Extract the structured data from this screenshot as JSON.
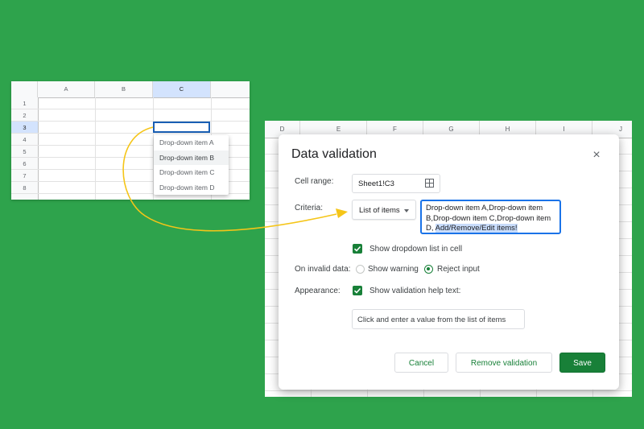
{
  "small_sheet": {
    "columns": [
      "A",
      "B",
      "C"
    ],
    "rows": [
      "1",
      "2",
      "3",
      "4",
      "5",
      "6",
      "7",
      "8"
    ],
    "dropdown_items": [
      "Drop-down item A",
      "Drop-down item B",
      "Drop-down item C",
      "Drop-down item D"
    ]
  },
  "big_sheet": {
    "columns": [
      "D",
      "E",
      "F",
      "G",
      "H",
      "I",
      "J"
    ]
  },
  "dialog": {
    "title": "Data validation",
    "close_icon": "×",
    "cell_range_label": "Cell range:",
    "cell_range_value": "Sheet1!C3",
    "criteria_label": "Criteria:",
    "criteria_value": "List of items",
    "items_text": "Drop-down item A,Drop-down item B,Drop-down item C,Drop-down item D, ",
    "items_selected": "Add/Remove/Edit items!",
    "show_dropdown_label": "Show dropdown list in cell",
    "invalid_label": "On invalid data:",
    "show_warning_label": "Show warning",
    "reject_input_label": "Reject input",
    "appearance_label": "Appearance:",
    "help_text_label": "Show validation help text:",
    "help_text_value": "Click and enter a value from the list of items",
    "cancel_label": "Cancel",
    "remove_label": "Remove validation",
    "save_label": "Save"
  },
  "colors": {
    "background": "#2ea34c",
    "accent_green": "#188038",
    "focus_blue": "#1a73e8",
    "arrow": "#f5c518"
  }
}
